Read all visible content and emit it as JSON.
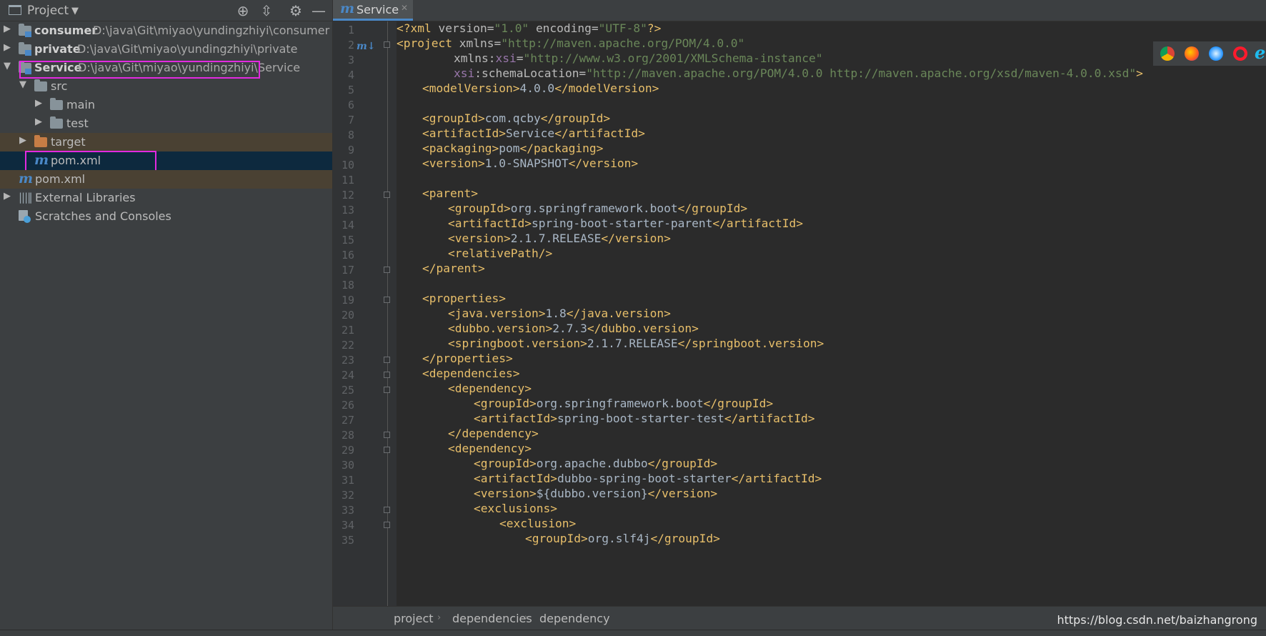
{
  "project_panel": {
    "title": "Project",
    "tree": [
      {
        "name": "consumer",
        "path": "D:\\java\\Git\\miyao\\yundingzhiyi\\consumer"
      },
      {
        "name": "private",
        "path": "D:\\java\\Git\\miyao\\yundingzhiyi\\private"
      },
      {
        "name": "Service",
        "path": "D:\\java\\Git\\miyao\\yundingzhiyi\\Service"
      },
      {
        "name": "src"
      },
      {
        "name": "main"
      },
      {
        "name": "test"
      },
      {
        "name": "target"
      },
      {
        "name": "pom.xml"
      },
      {
        "name": "pom.xml"
      },
      {
        "name": "External Libraries"
      },
      {
        "name": "Scratches and Consoles"
      }
    ]
  },
  "editor": {
    "tab_label": "Service",
    "line_numbers": [
      "1",
      "2",
      "3",
      "4",
      "5",
      "6",
      "7",
      "8",
      "9",
      "10",
      "11",
      "12",
      "13",
      "14",
      "15",
      "16",
      "17",
      "18",
      "19",
      "20",
      "21",
      "22",
      "23",
      "24",
      "25",
      "26",
      "27",
      "28",
      "29",
      "30",
      "31",
      "32",
      "33",
      "34",
      "35"
    ],
    "code": {
      "l1_tag": "<?xml",
      "l1_a1": "version=",
      "l1_v1": "\"1.0\"",
      "l1_a2": "encoding=",
      "l1_v2": "\"UTF-8\"",
      "l1_end": "?>",
      "l2_tag": "<project",
      "l2_a": "xmlns=",
      "l2_v": "\"http://maven.apache.org/POM/4.0.0\"",
      "l3_a": "xmlns:",
      "l3_ns": "xsi",
      "l3_eq": "=",
      "l3_v": "\"http://www.w3.org/2001/XMLSchema-instance\"",
      "l4_ns": "xsi",
      "l4_a": ":schemaLocation=",
      "l4_v": "\"http://maven.apache.org/POM/4.0.0 http://maven.apache.org/xsd/maven-4.0.0.xsd\"",
      "l4_end": ">",
      "l5_o": "<modelVersion>",
      "l5_t": "4.0.0",
      "l5_c": "</modelVersion>",
      "l7_o": "<groupId>",
      "l7_t": "com.qcby",
      "l7_c": "</groupId>",
      "l8_o": "<artifactId>",
      "l8_t": "Service",
      "l8_c": "</artifactId>",
      "l9_o": "<packaging>",
      "l9_t": "pom",
      "l9_c": "</packaging>",
      "l10_o": "<version>",
      "l10_t": "1.0-SNAPSHOT",
      "l10_c": "</version>",
      "l12": "<parent>",
      "l13_o": "<groupId>",
      "l13_t": "org.springframework.boot",
      "l13_c": "</groupId>",
      "l14_o": "<artifactId>",
      "l14_t": "spring-boot-starter-parent",
      "l14_c": "</artifactId>",
      "l15_o": "<version>",
      "l15_t": "2.1.7.RELEASE",
      "l15_c": "</version>",
      "l16": "<relativePath/>",
      "l17": "</parent>",
      "l19": "<properties>",
      "l20_o": "<java.version>",
      "l20_t": "1.8",
      "l20_c": "</java.version>",
      "l21_o": "<dubbo.version>",
      "l21_t": "2.7.3",
      "l21_c": "</dubbo.version>",
      "l22_o": "<springboot.version>",
      "l22_t": "2.1.7.RELEASE",
      "l22_c": "</springboot.version>",
      "l23": "</properties>",
      "l24": "<dependencies>",
      "l25": "<dependency>",
      "l26_o": "<groupId>",
      "l26_t": "org.springframework.boot",
      "l26_c": "</groupId>",
      "l27_o": "<artifactId>",
      "l27_t": "spring-boot-starter-test",
      "l27_c": "</artifactId>",
      "l28": "</dependency>",
      "l29": "<dependency>",
      "l30_o": "<groupId>",
      "l30_t": "org.apache.dubbo",
      "l30_c": "</groupId>",
      "l31_o": "<artifactId>",
      "l31_t": "dubbo-spring-boot-starter",
      "l31_c": "</artifactId>",
      "l32_o": "<version>",
      "l32_t": "${dubbo.version}",
      "l32_c": "</version>",
      "l33": "<exclusions>",
      "l34": "<exclusion>",
      "l35_o": "<groupId>",
      "l35_t": "org.slf4j",
      "l35_c": "</groupId>"
    }
  },
  "breadcrumbs": [
    "project",
    "dependencies",
    "dependency"
  ],
  "watermark": "https://blog.csdn.net/baizhangrong",
  "colors": {
    "highlight_box": "#e22ae0",
    "accent": "#4a88c7",
    "selection": "#0d293e"
  }
}
